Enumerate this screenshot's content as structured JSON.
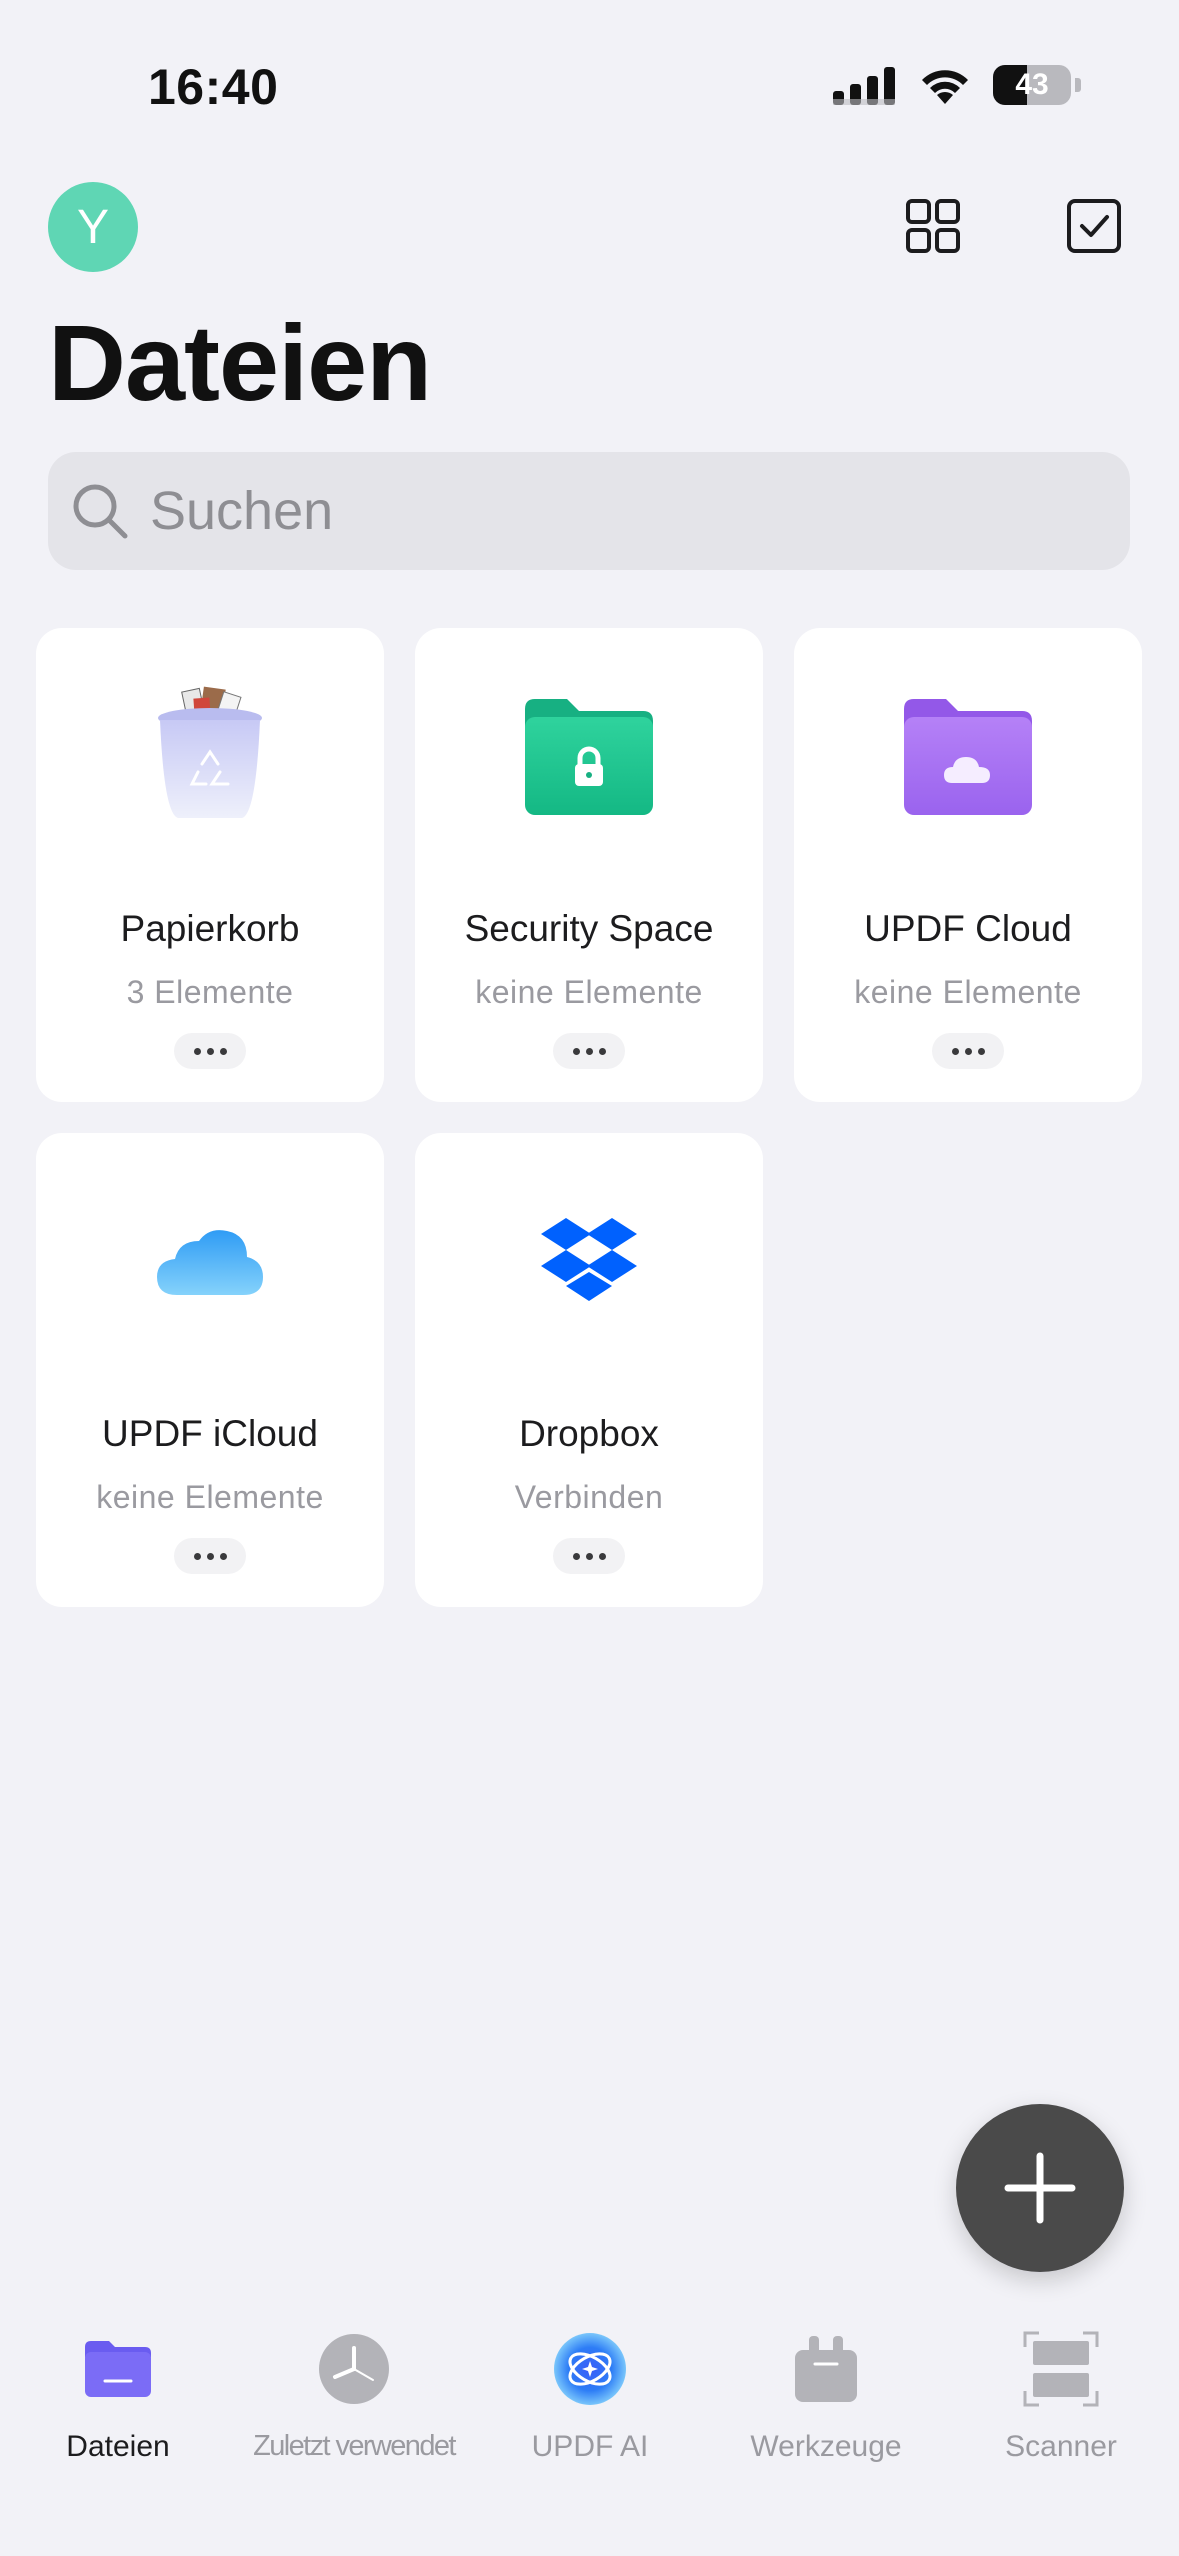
{
  "status_bar": {
    "time": "16:40",
    "battery": "43"
  },
  "header": {
    "avatar_letter": "Y",
    "title": "Dateien"
  },
  "search": {
    "placeholder": "Suchen"
  },
  "cards": [
    {
      "title": "Papierkorb",
      "subtitle": "3 Elemente",
      "icon": "trash-icon"
    },
    {
      "title": "Security Space",
      "subtitle": "keine Elemente",
      "icon": "lock-folder-icon"
    },
    {
      "title": "UPDF Cloud",
      "subtitle": "keine Elemente",
      "icon": "cloud-folder-icon"
    },
    {
      "title": "UPDF iCloud",
      "subtitle": "keine Elemente",
      "icon": "icloud-icon"
    },
    {
      "title": "Dropbox",
      "subtitle": "Verbinden",
      "icon": "dropbox-icon"
    }
  ],
  "tabs": [
    {
      "label": "Dateien",
      "icon": "folder-icon",
      "active": true
    },
    {
      "label": "Zuletzt verwendet",
      "icon": "clock-icon"
    },
    {
      "label": "UPDF AI",
      "icon": "ai-icon"
    },
    {
      "label": "Werkzeuge",
      "icon": "toolbox-icon"
    },
    {
      "label": "Scanner",
      "icon": "scanner-icon"
    }
  ],
  "colors": {
    "background": "#f2f2f7",
    "avatar": "#5fd6b4",
    "security_folder": "#1fc08f",
    "cloud_folder": "#a46ef2",
    "dropbox": "#0061fe",
    "active_tab": "#7b6cf6",
    "fab": "#4a4a4a"
  }
}
